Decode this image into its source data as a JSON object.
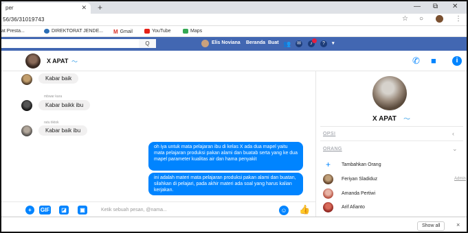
{
  "browser": {
    "tab_title": "per",
    "url": "56/36/31019743",
    "bookmarks": [
      "at Presta...",
      "DIREKTORAT JENDE...",
      "Gmail",
      "YouTube",
      "Maps"
    ]
  },
  "facebook": {
    "search_glyph": "Q",
    "user_name": "Elis Noviana",
    "nav": [
      "Beranda",
      "Buat"
    ]
  },
  "thread": {
    "title": "X APAT",
    "messages_in": [
      {
        "sender": "",
        "text": "Kabar baik"
      },
      {
        "sender": "mbwar kara",
        "text": "Kabar baikk ibu"
      },
      {
        "sender": "ratu tiktok",
        "text": "Kabar baik ibu"
      }
    ],
    "messages_out": [
      "oh iya untuk mata pelajaran ibu di kelas X ada dua mapel yaitu mata pelajaran produksi pakan alami dan buatab serta yang ke dua mapel parameter kualitas air dan hama penyakit",
      "ini adalah materi mata pelajaran produksi pakan alami dan buatan, silahkan di pelajari, pada akhir materi ada soal yang harus kalian kerjakan."
    ],
    "composer_placeholder": "Ketik sebuah pesan, @nama...",
    "gif_label": "GIF"
  },
  "panel": {
    "group_name": "X APAT",
    "sections": [
      "OPSI",
      "ORANG"
    ],
    "add_people": "Tambahkan Orang",
    "people": [
      {
        "name": "Feriyan Sladiduz",
        "role": "Admin"
      },
      {
        "name": "Amanda Pertiwi",
        "role": ""
      },
      {
        "name": "Arif Afianto",
        "role": ""
      }
    ]
  },
  "downloads": {
    "show_all": "Show all",
    "close": "×"
  },
  "colors": {
    "facebook_blue": "#4267b2",
    "messenger_blue": "#0084ff",
    "bubble_gray": "#f1f0f0"
  }
}
